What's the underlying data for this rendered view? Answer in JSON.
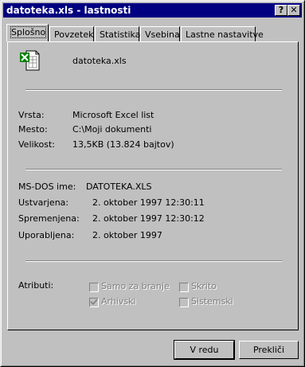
{
  "window": {
    "title": "datoteka.xls - lastnosti",
    "help_button": "?",
    "close_button": "✕"
  },
  "tabs": [
    {
      "label": "Splošno"
    },
    {
      "label": "Povzetek"
    },
    {
      "label": "Statistika"
    },
    {
      "label": "Vsebina"
    },
    {
      "label": "Lastne nastavitve"
    }
  ],
  "file": {
    "icon": "excel-file-icon",
    "name": "datoteka.xls"
  },
  "general": {
    "type_label": "Vrsta:",
    "type_value": "Microsoft Excel list",
    "location_label": "Mesto:",
    "location_value": "C:\\Moji dokumenti",
    "size_label": "Velikost:",
    "size_value": "13,5KB (13.824 bajtov)"
  },
  "details": {
    "msdos_label": "MS-DOS ime:",
    "msdos_value": "DATOTEKA.XLS",
    "created_label": "Ustvarjena:",
    "created_value": "2. oktober 1997 12:30:11",
    "modified_label": "Spremenjena:",
    "modified_value": "2. oktober 1997 12:30:12",
    "accessed_label": "Uporabljena:",
    "accessed_value": "2. oktober 1997"
  },
  "attributes": {
    "label": "Atributi:",
    "readonly": {
      "label": "Samo za branje",
      "checked": false
    },
    "hidden": {
      "label": "Skrito",
      "checked": false
    },
    "archive": {
      "label": "Arhivski",
      "checked": true
    },
    "system": {
      "label": "Sistemski",
      "checked": false
    }
  },
  "buttons": {
    "ok": "V redu",
    "cancel": "Prekliči"
  }
}
